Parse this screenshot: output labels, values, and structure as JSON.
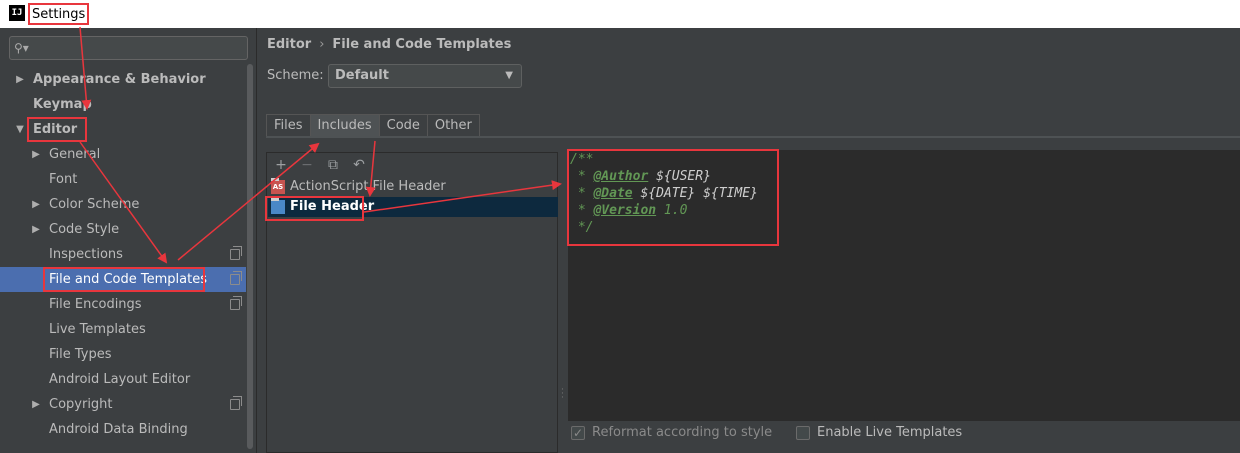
{
  "window": {
    "app_icon": "IJ",
    "title": "Settings"
  },
  "search": {
    "placeholder": "",
    "value": ""
  },
  "sidebar": {
    "items": [
      {
        "label": "Appearance & Behavior",
        "arrow": "▶"
      },
      {
        "label": "Keymap",
        "arrow": ""
      },
      {
        "label": "Editor",
        "arrow": "▼"
      },
      {
        "label": "General",
        "arrow": "▶"
      },
      {
        "label": "Font",
        "arrow": ""
      },
      {
        "label": "Color Scheme",
        "arrow": "▶"
      },
      {
        "label": "Code Style",
        "arrow": "▶"
      },
      {
        "label": "Inspections",
        "arrow": ""
      },
      {
        "label": "File and Code Templates",
        "arrow": ""
      },
      {
        "label": "File Encodings",
        "arrow": ""
      },
      {
        "label": "Live Templates",
        "arrow": ""
      },
      {
        "label": "File Types",
        "arrow": ""
      },
      {
        "label": "Android Layout Editor",
        "arrow": ""
      },
      {
        "label": "Copyright",
        "arrow": "▶"
      },
      {
        "label": "Android Data Binding",
        "arrow": ""
      }
    ]
  },
  "breadcrumb": {
    "parent": "Editor",
    "sep": "›",
    "current": "File and Code Templates"
  },
  "scheme": {
    "label": "Scheme:",
    "value": "Default"
  },
  "tabs": [
    {
      "label": "Files"
    },
    {
      "label": "Includes"
    },
    {
      "label": "Code"
    },
    {
      "label": "Other"
    }
  ],
  "toolbar": {
    "add": "+",
    "remove": "−",
    "copy": "⧉",
    "reset": "↶"
  },
  "templates": [
    {
      "icon_text": "AS",
      "label": "ActionScript File Header"
    },
    {
      "icon_text": "",
      "label": "File Header"
    }
  ],
  "editor": {
    "line1": "/**",
    "line2_star": " * ",
    "line2_tag": "@Author",
    "line2_var": "${USER}",
    "line3_star": " * ",
    "line3_tag": "@Date",
    "line3_var1": "${DATE}",
    "line3_var2": "${TIME}",
    "line4_star": " * ",
    "line4_tag": "@Version",
    "line4_val": " 1.0",
    "line5": " */"
  },
  "options": {
    "reformat": "Reformat according to style",
    "enable_live": "Enable Live Templates"
  },
  "colors": {
    "background": "#3c3f41",
    "selection": "#4b6eaf",
    "editor_bg": "#2b2b2b",
    "comment": "#629755",
    "annotation": "#e8363d"
  }
}
